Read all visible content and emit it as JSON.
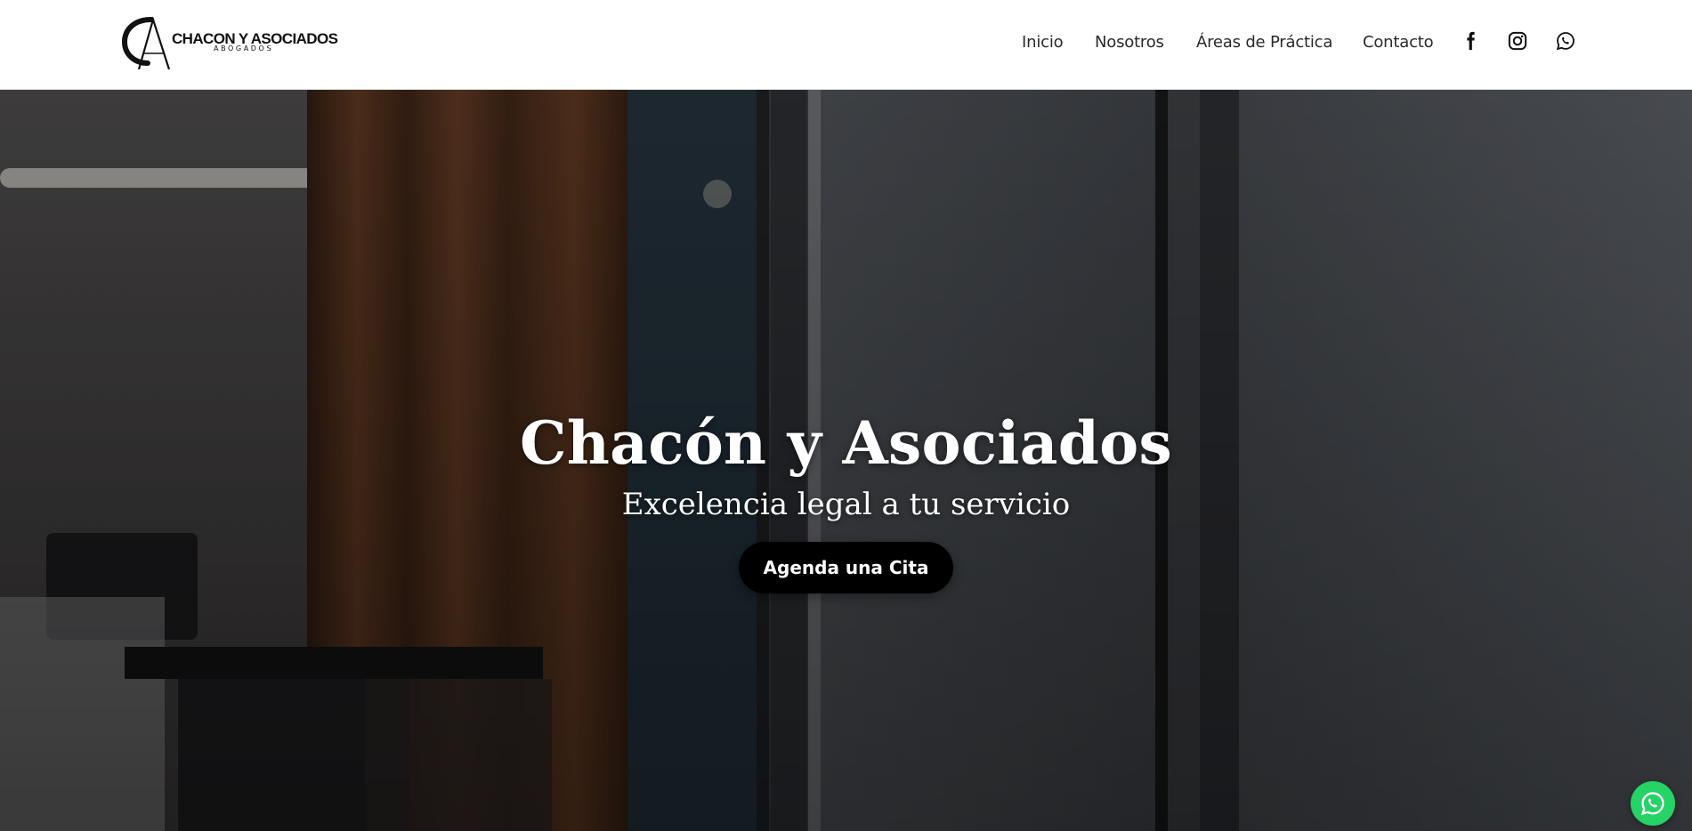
{
  "header": {
    "logo": {
      "monogram": "CA",
      "name": "CHACON Y ASOCIADOS",
      "subtitle": "ABOGADOS"
    },
    "nav": [
      {
        "label": "Inicio"
      },
      {
        "label": "Nosotros"
      },
      {
        "label": "Áreas de Práctica"
      },
      {
        "label": "Contacto"
      }
    ],
    "social": [
      {
        "icon": "facebook-icon"
      },
      {
        "icon": "instagram-icon"
      },
      {
        "icon": "whatsapp-icon"
      }
    ]
  },
  "hero": {
    "title": "Chacón y Asociados",
    "subtitle": "Excelencia legal a tu servicio",
    "cta_label": "Agenda una Cita"
  },
  "floating": {
    "icon": "whatsapp-icon",
    "color": "#25d366"
  },
  "colors": {
    "header_bg": "#ffffff",
    "text_dark": "#2a2a2a",
    "button_bg": "#000000",
    "hero_text": "#ffffff"
  }
}
